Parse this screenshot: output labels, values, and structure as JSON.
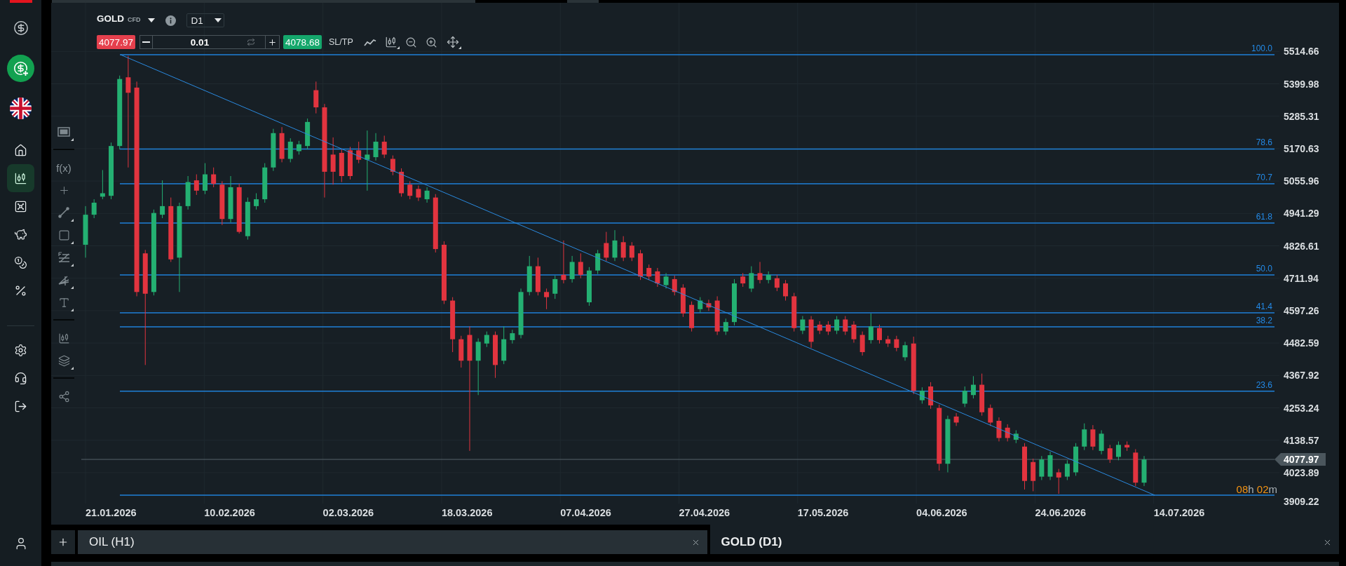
{
  "sidebar": {
    "nav_items": [
      {
        "selected": false
      },
      {
        "selected": true
      },
      {
        "selected": false
      },
      {
        "selected": false
      },
      {
        "selected": false
      },
      {
        "selected": false
      }
    ]
  },
  "chart_toolbar": {
    "symbol": "GOLD",
    "symbol_type": "CFD",
    "timeframe": "D1",
    "sell_price": "4077.97",
    "quantity": "0.01",
    "buy_price": "4078.68",
    "sl_tp": "SL/TP"
  },
  "drawing_tools": {
    "function_label": "f(x)"
  },
  "chart": {
    "fib_levels": [
      {
        "label": "100.0"
      },
      {
        "label": "78.6"
      },
      {
        "label": "70.7"
      },
      {
        "label": "61.8"
      },
      {
        "label": "50.0"
      },
      {
        "label": "41.4"
      },
      {
        "label": "38.2"
      },
      {
        "label": "23.6"
      }
    ],
    "price_labels": [
      "5514.66",
      "5399.98",
      "5285.31",
      "5170.63",
      "5055.96",
      "4941.29",
      "4826.61",
      "4711.94",
      "4597.26",
      "4482.59",
      "4367.92",
      "4253.24",
      "4138.57",
      "4023.89",
      "3909.22"
    ],
    "current_price": "4077.97",
    "countdown": "08h 02m",
    "date_labels": [
      "21.01.2026",
      "10.02.2026",
      "02.03.2026",
      "18.03.2026",
      "07.04.2026",
      "27.04.2026",
      "17.05.2026",
      "04.06.2026",
      "24.06.2026",
      "14.07.2026"
    ]
  },
  "tabs": [
    {
      "label": "OIL (H1)",
      "selected": false
    },
    {
      "label": "GOLD (D1)",
      "selected": true
    }
  ]
}
